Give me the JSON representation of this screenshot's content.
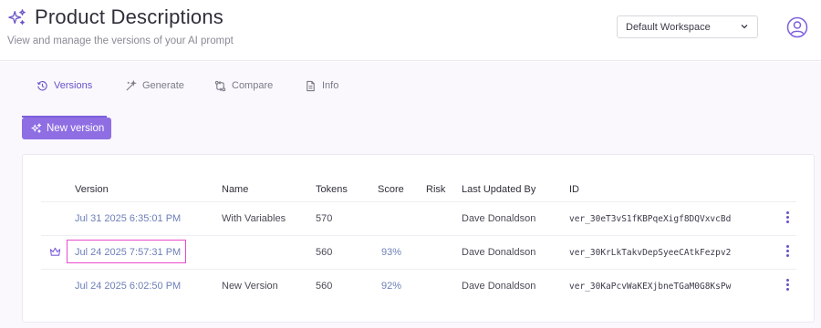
{
  "header": {
    "title": "Product Descriptions",
    "subtitle": "View and manage the versions of your AI prompt",
    "workspace": "Default Workspace"
  },
  "tabs": [
    {
      "label": "Versions",
      "icon": "history-icon",
      "active": true
    },
    {
      "label": "Generate",
      "icon": "magic-wand-icon",
      "active": false
    },
    {
      "label": "Compare",
      "icon": "compare-arrows-icon",
      "active": false
    },
    {
      "label": "Info",
      "icon": "document-icon",
      "active": false
    }
  ],
  "new_version_label": "New version",
  "table": {
    "columns": [
      "Version",
      "Name",
      "Tokens",
      "Score",
      "Risk",
      "Last Updated By",
      "ID"
    ],
    "rows": [
      {
        "version": "Jul 31 2025 6:35:01 PM",
        "name": "With Variables",
        "tokens": "570",
        "score": "",
        "risk": "",
        "updated_by": "Dave Donaldson",
        "id": "ver_30eT3vS1fKBPqeXigf8DQVxvcBd",
        "crown": false
      },
      {
        "version": "Jul 24 2025 7:57:31 PM",
        "name": "",
        "tokens": "560",
        "score": "93%",
        "risk": "",
        "updated_by": "Dave Donaldson",
        "id": "ver_30KrLkTakvDepSyeeCAtkFezpv2",
        "crown": true
      },
      {
        "version": "Jul 24 2025 6:02:50 PM",
        "name": "New Version",
        "tokens": "560",
        "score": "92%",
        "risk": "",
        "updated_by": "Dave Donaldson",
        "id": "ver_30KaPcvWaKEXjbneTGaM0G8KsPw",
        "crown": false
      }
    ]
  },
  "colors": {
    "accent": "#8f6ee3",
    "link": "#6d7fb8",
    "highlight": "#e84bcb"
  }
}
